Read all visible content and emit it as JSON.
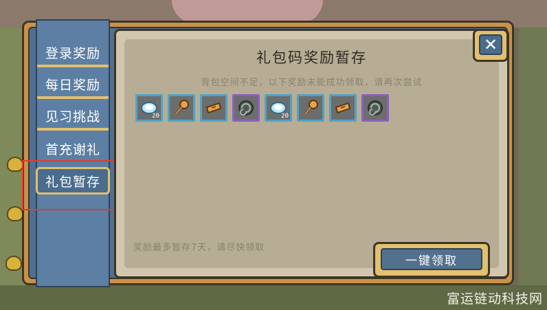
{
  "sidebar": {
    "tabs": [
      {
        "label": "登录奖励"
      },
      {
        "label": "每日奖励"
      },
      {
        "label": "见习挑战"
      },
      {
        "label": "首充谢礼"
      }
    ],
    "active_tab": {
      "label": "礼包暂存"
    }
  },
  "panel": {
    "title": "礼包码奖励暂存",
    "subtitle": "背包空间不足，以下奖励未能成功领取，请再次尝试",
    "footnote": "奖励最多暂存7天，请尽快领取",
    "claim_button": "一键领取",
    "close_label": "✕",
    "items": [
      {
        "icon": "gem-icon",
        "rarity": "rare",
        "count": "20"
      },
      {
        "icon": "key-icon",
        "rarity": "rare",
        "count": ""
      },
      {
        "icon": "ticket-icon",
        "rarity": "rare",
        "count": ""
      },
      {
        "icon": "spiral-icon",
        "rarity": "epic",
        "count": ""
      },
      {
        "icon": "gem-icon",
        "rarity": "rare",
        "count": "20"
      },
      {
        "icon": "key-icon",
        "rarity": "rare",
        "count": ""
      },
      {
        "icon": "ticket-icon",
        "rarity": "rare",
        "count": ""
      },
      {
        "icon": "spiral-icon",
        "rarity": "epic",
        "count": ""
      }
    ]
  },
  "watermark": "富运链动科技网",
  "colors": {
    "frame": "#c9924a",
    "sidebar": "#5c7fa3",
    "accent": "#e2c06f",
    "highlight": "#e53b2f",
    "rare_border": "#4ea3c6",
    "epic_border": "#8b5fc0"
  }
}
